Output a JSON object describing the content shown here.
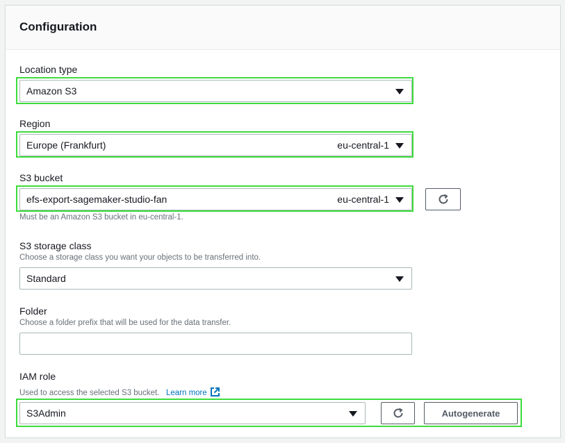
{
  "panel": {
    "title": "Configuration"
  },
  "location_type": {
    "label": "Location type",
    "value": "Amazon S3"
  },
  "region": {
    "label": "Region",
    "value": "Europe (Frankfurt)",
    "code": "eu-central-1"
  },
  "s3_bucket": {
    "label": "S3 bucket",
    "value": "efs-export-sagemaker-studio-fan",
    "region_code": "eu-central-1",
    "hint": "Must be an Amazon S3 bucket in eu-central-1."
  },
  "storage_class": {
    "label": "S3 storage class",
    "description": "Choose a storage class you want your objects to be transferred into.",
    "value": "Standard"
  },
  "folder": {
    "label": "Folder",
    "description": "Choose a folder prefix that will be used for the data transfer.",
    "value": ""
  },
  "iam_role": {
    "label": "IAM role",
    "description": "Used to access the selected S3 bucket.",
    "learn_more": "Learn more",
    "value": "S3Admin",
    "autogenerate_label": "Autogenerate"
  },
  "icons": {
    "refresh": "refresh-icon",
    "caret": "caret-down-icon",
    "external": "external-link-icon"
  },
  "colors": {
    "highlight": "#3cdc3c",
    "link": "#0073bb",
    "border": "#aab7b8"
  }
}
